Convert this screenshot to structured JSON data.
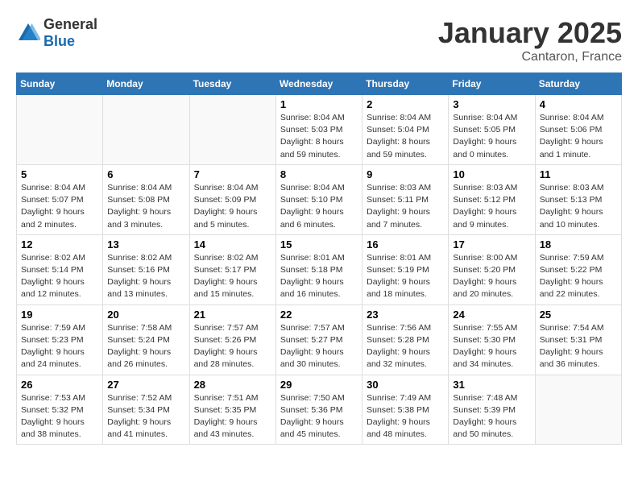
{
  "header": {
    "logo_general": "General",
    "logo_blue": "Blue",
    "month": "January 2025",
    "location": "Cantaron, France"
  },
  "weekdays": [
    "Sunday",
    "Monday",
    "Tuesday",
    "Wednesday",
    "Thursday",
    "Friday",
    "Saturday"
  ],
  "weeks": [
    [
      {
        "day": "",
        "info": ""
      },
      {
        "day": "",
        "info": ""
      },
      {
        "day": "",
        "info": ""
      },
      {
        "day": "1",
        "info": "Sunrise: 8:04 AM\nSunset: 5:03 PM\nDaylight: 8 hours\nand 59 minutes."
      },
      {
        "day": "2",
        "info": "Sunrise: 8:04 AM\nSunset: 5:04 PM\nDaylight: 8 hours\nand 59 minutes."
      },
      {
        "day": "3",
        "info": "Sunrise: 8:04 AM\nSunset: 5:05 PM\nDaylight: 9 hours\nand 0 minutes."
      },
      {
        "day": "4",
        "info": "Sunrise: 8:04 AM\nSunset: 5:06 PM\nDaylight: 9 hours\nand 1 minute."
      }
    ],
    [
      {
        "day": "5",
        "info": "Sunrise: 8:04 AM\nSunset: 5:07 PM\nDaylight: 9 hours\nand 2 minutes."
      },
      {
        "day": "6",
        "info": "Sunrise: 8:04 AM\nSunset: 5:08 PM\nDaylight: 9 hours\nand 3 minutes."
      },
      {
        "day": "7",
        "info": "Sunrise: 8:04 AM\nSunset: 5:09 PM\nDaylight: 9 hours\nand 5 minutes."
      },
      {
        "day": "8",
        "info": "Sunrise: 8:04 AM\nSunset: 5:10 PM\nDaylight: 9 hours\nand 6 minutes."
      },
      {
        "day": "9",
        "info": "Sunrise: 8:03 AM\nSunset: 5:11 PM\nDaylight: 9 hours\nand 7 minutes."
      },
      {
        "day": "10",
        "info": "Sunrise: 8:03 AM\nSunset: 5:12 PM\nDaylight: 9 hours\nand 9 minutes."
      },
      {
        "day": "11",
        "info": "Sunrise: 8:03 AM\nSunset: 5:13 PM\nDaylight: 9 hours\nand 10 minutes."
      }
    ],
    [
      {
        "day": "12",
        "info": "Sunrise: 8:02 AM\nSunset: 5:14 PM\nDaylight: 9 hours\nand 12 minutes."
      },
      {
        "day": "13",
        "info": "Sunrise: 8:02 AM\nSunset: 5:16 PM\nDaylight: 9 hours\nand 13 minutes."
      },
      {
        "day": "14",
        "info": "Sunrise: 8:02 AM\nSunset: 5:17 PM\nDaylight: 9 hours\nand 15 minutes."
      },
      {
        "day": "15",
        "info": "Sunrise: 8:01 AM\nSunset: 5:18 PM\nDaylight: 9 hours\nand 16 minutes."
      },
      {
        "day": "16",
        "info": "Sunrise: 8:01 AM\nSunset: 5:19 PM\nDaylight: 9 hours\nand 18 minutes."
      },
      {
        "day": "17",
        "info": "Sunrise: 8:00 AM\nSunset: 5:20 PM\nDaylight: 9 hours\nand 20 minutes."
      },
      {
        "day": "18",
        "info": "Sunrise: 7:59 AM\nSunset: 5:22 PM\nDaylight: 9 hours\nand 22 minutes."
      }
    ],
    [
      {
        "day": "19",
        "info": "Sunrise: 7:59 AM\nSunset: 5:23 PM\nDaylight: 9 hours\nand 24 minutes."
      },
      {
        "day": "20",
        "info": "Sunrise: 7:58 AM\nSunset: 5:24 PM\nDaylight: 9 hours\nand 26 minutes."
      },
      {
        "day": "21",
        "info": "Sunrise: 7:57 AM\nSunset: 5:26 PM\nDaylight: 9 hours\nand 28 minutes."
      },
      {
        "day": "22",
        "info": "Sunrise: 7:57 AM\nSunset: 5:27 PM\nDaylight: 9 hours\nand 30 minutes."
      },
      {
        "day": "23",
        "info": "Sunrise: 7:56 AM\nSunset: 5:28 PM\nDaylight: 9 hours\nand 32 minutes."
      },
      {
        "day": "24",
        "info": "Sunrise: 7:55 AM\nSunset: 5:30 PM\nDaylight: 9 hours\nand 34 minutes."
      },
      {
        "day": "25",
        "info": "Sunrise: 7:54 AM\nSunset: 5:31 PM\nDaylight: 9 hours\nand 36 minutes."
      }
    ],
    [
      {
        "day": "26",
        "info": "Sunrise: 7:53 AM\nSunset: 5:32 PM\nDaylight: 9 hours\nand 38 minutes."
      },
      {
        "day": "27",
        "info": "Sunrise: 7:52 AM\nSunset: 5:34 PM\nDaylight: 9 hours\nand 41 minutes."
      },
      {
        "day": "28",
        "info": "Sunrise: 7:51 AM\nSunset: 5:35 PM\nDaylight: 9 hours\nand 43 minutes."
      },
      {
        "day": "29",
        "info": "Sunrise: 7:50 AM\nSunset: 5:36 PM\nDaylight: 9 hours\nand 45 minutes."
      },
      {
        "day": "30",
        "info": "Sunrise: 7:49 AM\nSunset: 5:38 PM\nDaylight: 9 hours\nand 48 minutes."
      },
      {
        "day": "31",
        "info": "Sunrise: 7:48 AM\nSunset: 5:39 PM\nDaylight: 9 hours\nand 50 minutes."
      },
      {
        "day": "",
        "info": ""
      }
    ]
  ]
}
